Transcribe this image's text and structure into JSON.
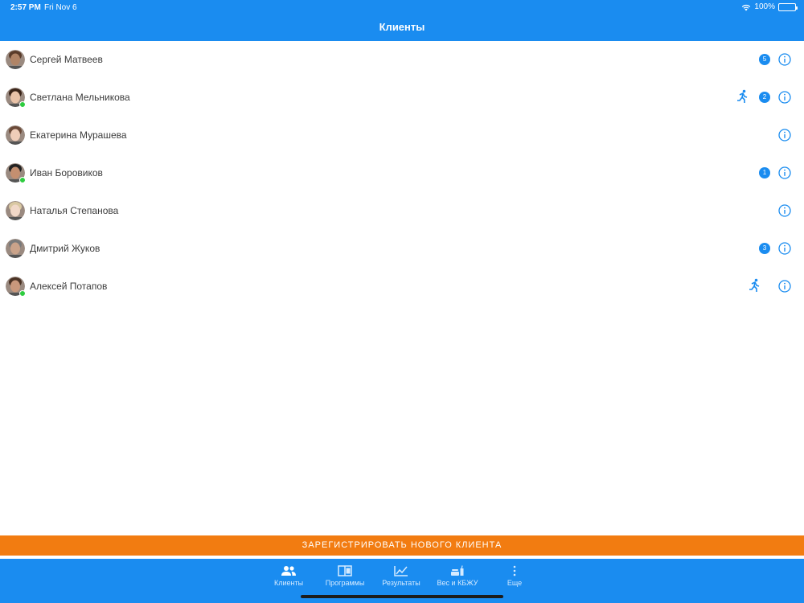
{
  "status_bar": {
    "time": "2:57 PM",
    "date": "Fri Nov 6",
    "battery": "100%"
  },
  "header": {
    "title": "Клиенты"
  },
  "clients": [
    {
      "name": "Сергей Матвеев",
      "online": false,
      "running": false,
      "badge": "5",
      "skin": "#b08466",
      "hair": "#5a3c2a"
    },
    {
      "name": "Светлана Мельникова",
      "online": true,
      "running": true,
      "badge": "2",
      "skin": "#e9c2a7",
      "hair": "#3a2418"
    },
    {
      "name": "Екатерина Мурашева",
      "online": false,
      "running": false,
      "badge": "",
      "skin": "#efcdb9",
      "hair": "#6b4a38"
    },
    {
      "name": "Иван Боровиков",
      "online": true,
      "running": false,
      "badge": "1",
      "skin": "#c48f70",
      "hair": "#222222"
    },
    {
      "name": "Наталья Степанова",
      "online": false,
      "running": false,
      "badge": "",
      "skin": "#f1d8c8",
      "hair": "#d9c8a2"
    },
    {
      "name": "Дмитрий Жуков",
      "online": false,
      "running": false,
      "badge": "3",
      "skin": "#caa38a",
      "hair": "#7a7a7a"
    },
    {
      "name": "Алексей Потапов",
      "online": true,
      "running": true,
      "badge": "",
      "skin": "#c9987c",
      "hair": "#4b3325"
    }
  ],
  "register_button": "ЗАРЕГИСТРИРОВАТЬ НОВОГО КЛИЕНТА",
  "tabs": [
    {
      "label": "Клиенты",
      "icon": "people-icon",
      "active": true
    },
    {
      "label": "Программы",
      "icon": "book-icon",
      "active": false
    },
    {
      "label": "Результаты",
      "icon": "chart-icon",
      "active": false
    },
    {
      "label": "Вес и КБЖУ",
      "icon": "food-icon",
      "active": false
    },
    {
      "label": "Еще",
      "icon": "more-icon",
      "active": false
    }
  ],
  "colors": {
    "brand": "#1a8cf0",
    "accent": "#f27c11",
    "online": "#2ecc40"
  }
}
